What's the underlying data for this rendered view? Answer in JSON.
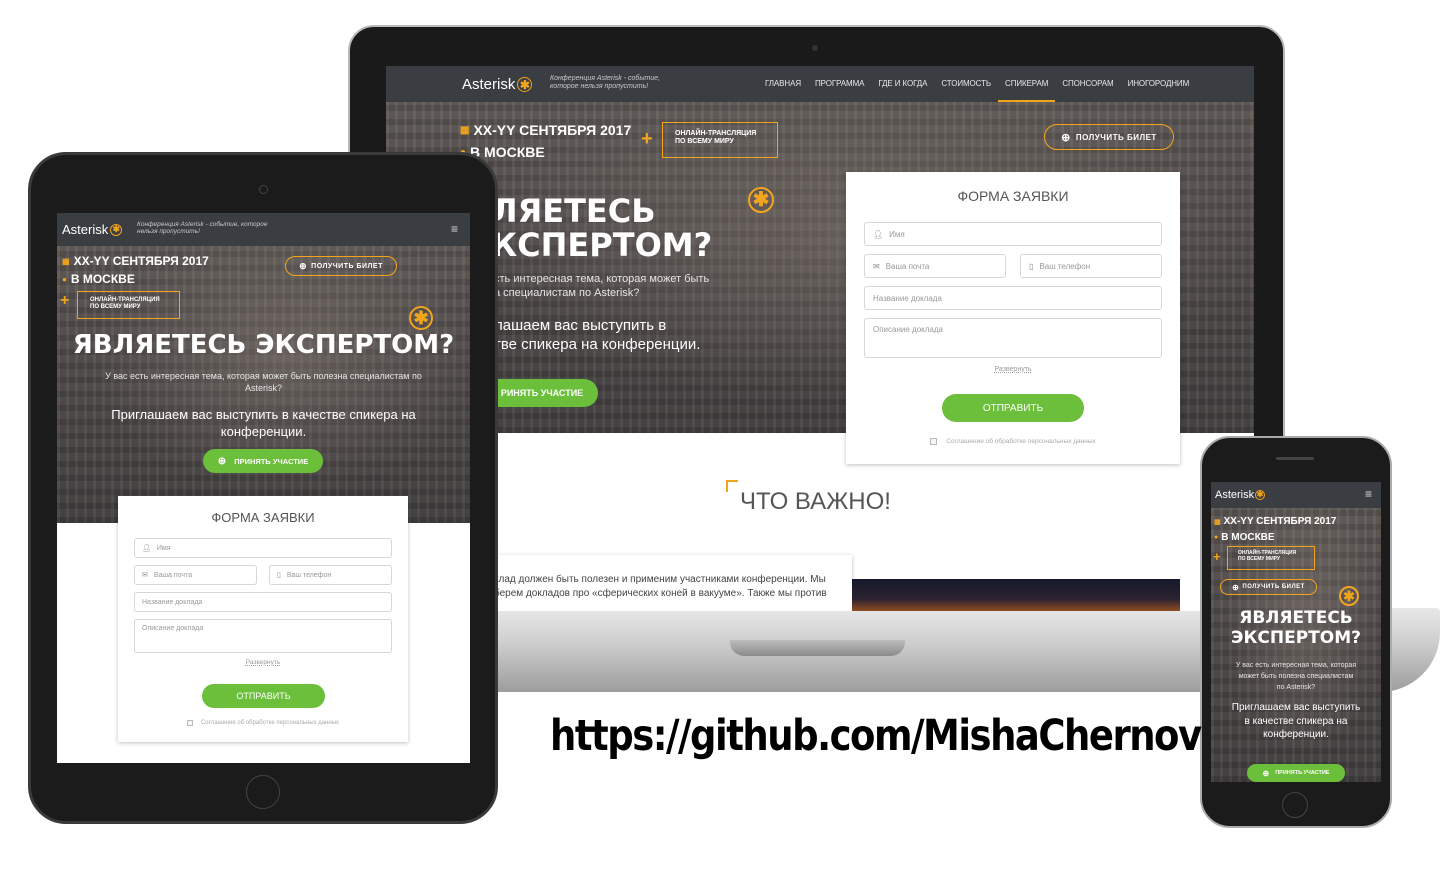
{
  "brand": {
    "logo": "Asterisk",
    "tagline": "Конференция Asterisk - событие, которое нельзя пропустить!",
    "accent_color": "#f2a51c",
    "green_color": "#6cbf3a"
  },
  "nav": {
    "items": [
      "ГЛАВНАЯ",
      "ПРОГРАММА",
      "ГДЕ И КОГДА",
      "СТОИМОСТЬ",
      "СПИКЕРАМ",
      "СПОНСОРАМ",
      "ИНОГОРОДНИМ"
    ],
    "active": "СПИКЕРАМ",
    "menu_icon": "hamburger-icon"
  },
  "event": {
    "date": "XX-YY СЕНТЯБРЯ 2017",
    "city": "В МОСКВЕ",
    "stream_line1": "ОНЛАЙН-ТРАНСЛЯЦИЯ",
    "stream_line2": "ПО ВСЕМУ МИРУ",
    "ticket_button": "ПОЛУЧИТЬ БИЛЕТ"
  },
  "hero": {
    "title": "ЯВЛЯЕТЕСЬ ЭКСПЕРТОМ?",
    "title_line1": "ЯВЛЯЕТЕСЬ",
    "title_line2": "ЭКСПЕРТОМ?",
    "laptop_title_line1": "ЛЯЕТЕСЬ",
    "laptop_title_line2": "КСПЕРТОМ?",
    "subtitle": "У вас есть интересная тема, которая может быть полезна специалистам по Asterisk?",
    "laptop_subtitle_line1": "сть интересная тема, которая может быть",
    "laptop_subtitle_line2": "а специалистам по Asterisk?",
    "invite": "Приглашаем вас выступить в качестве спикера на конференции.",
    "laptop_invite_line1": "лашаем вас выступить в",
    "laptop_invite_line2": "тве спикера на конференции.",
    "participate_button": "ПРИНЯТЬ УЧАСТИЕ",
    "laptop_participate_button": "РИНЯТЬ УЧАСТИЕ"
  },
  "form": {
    "title": "ФОРМА ЗАЯВКИ",
    "name_placeholder": "Имя",
    "email_placeholder": "Ваша почта",
    "phone_placeholder": "Ваш телефон",
    "talk_title_placeholder": "Название доклада",
    "talk_desc_placeholder": "Описание доклада",
    "expand_link": "Развернуть",
    "submit_button": "ОТПРАВИТЬ",
    "consent": "Соглашение об обработке персональных данных"
  },
  "important": {
    "heading": "ЧТО ВАЖНО!",
    "text_line1": "клад должен быть полезен и применим участниками конференции. Мы",
    "text_line2": "берем докладов про «сферических коней в вакууме». Также мы против"
  },
  "footer_url": "https://github.com/MishaChernov"
}
